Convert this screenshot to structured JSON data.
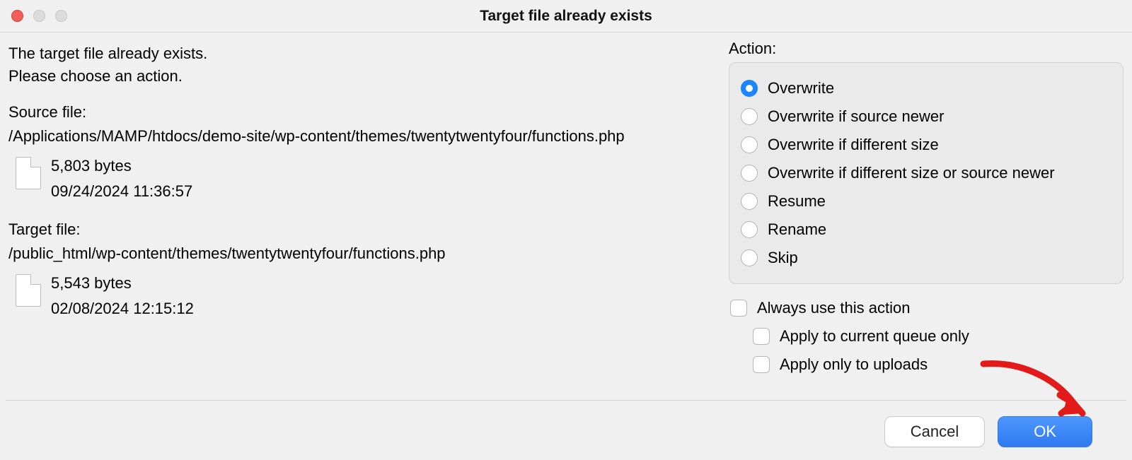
{
  "window": {
    "title": "Target file already exists"
  },
  "message": {
    "line1": "The target file already exists.",
    "line2": "Please choose an action."
  },
  "source": {
    "label": "Source file:",
    "path": "/Applications/MAMP/htdocs/demo-site/wp-content/themes/twentytwentyfour/functions.php",
    "size": "5,803 bytes",
    "date": "09/24/2024 11:36:57"
  },
  "target": {
    "label": "Target file:",
    "path": "/public_html/wp-content/themes/twentytwentyfour/functions.php",
    "size": "5,543 bytes",
    "date": "02/08/2024 12:15:12"
  },
  "action_panel": {
    "label": "Action:",
    "options": [
      {
        "label": "Overwrite",
        "selected": true
      },
      {
        "label": "Overwrite if source newer",
        "selected": false
      },
      {
        "label": "Overwrite if different size",
        "selected": false
      },
      {
        "label": "Overwrite if different size or source newer",
        "selected": false
      },
      {
        "label": "Resume",
        "selected": false
      },
      {
        "label": "Rename",
        "selected": false
      },
      {
        "label": "Skip",
        "selected": false
      }
    ],
    "checkboxes": [
      {
        "label": "Always use this action",
        "checked": false,
        "indent": false
      },
      {
        "label": "Apply to current queue only",
        "checked": false,
        "indent": true
      },
      {
        "label": "Apply only to uploads",
        "checked": false,
        "indent": true
      }
    ]
  },
  "buttons": {
    "cancel": "Cancel",
    "ok": "OK"
  }
}
